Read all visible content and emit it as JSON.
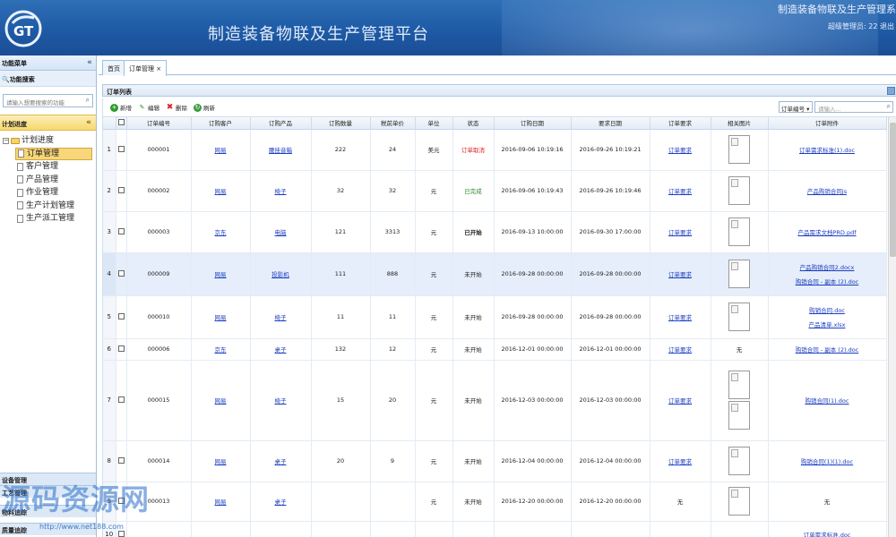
{
  "header": {
    "app_title": "制造装备物联及生产管理平台",
    "corner_title": "制造装备物联及生产管理系",
    "user_info": "超级管理员: 22  退出",
    "colors": {
      "primary": "#1e5aa6",
      "accent": "#f6d86e"
    }
  },
  "sidebar": {
    "title": "功能菜单",
    "collapse_icon": "«",
    "search_title": "功能搜索",
    "search_placeholder": "请输入想要搜索的功能",
    "plan_title": "计划进度",
    "tree_root": "计划进度",
    "items": [
      {
        "label": "订单管理",
        "selected": true
      },
      {
        "label": "客户管理",
        "selected": false
      },
      {
        "label": "产品管理",
        "selected": false
      },
      {
        "label": "作业管理",
        "selected": false
      },
      {
        "label": "生产计划管理",
        "selected": false
      },
      {
        "label": "生产派工管理",
        "selected": false
      }
    ],
    "bottom_panels": [
      "设备管理",
      "工艺管理",
      "物料追踪",
      "质量追踪"
    ]
  },
  "watermark": {
    "text": "源码资源网",
    "url": "http://www.net188.com"
  },
  "tabs": [
    {
      "label": "首页",
      "active": false
    },
    {
      "label": "订单管理",
      "active": true,
      "close": "×"
    }
  ],
  "panel": {
    "title": "订单列表"
  },
  "toolbar": {
    "add": "新增",
    "edit": "编辑",
    "delete": "删除",
    "refresh": "刷新",
    "search_field": "订单编号",
    "search_placeholder": "请输入..."
  },
  "table": {
    "columns": [
      "订单编号",
      "订购客户",
      "订购产品",
      "订购数量",
      "税前单价",
      "单位",
      "状态",
      "订购日期",
      "要求日期",
      "订单要求",
      "相关图片",
      "订单附件"
    ],
    "rows": [
      {
        "n": "1",
        "id": "000001",
        "customer": "网易",
        "product": "腰挂音箱",
        "qty": "222",
        "price": "24",
        "unit": "美元",
        "status": "订单取消",
        "status_style": "red",
        "order_date": "2016-09-06 10:19:16",
        "req_date": "2016-09-26 10:19:21",
        "req": "订单要求",
        "images": 1,
        "attachments": [
          "订单需求标准(1).doc"
        ]
      },
      {
        "n": "2",
        "id": "000002",
        "customer": "网易",
        "product": "椅子",
        "qty": "32",
        "price": "32",
        "unit": "元",
        "status": "已完成",
        "status_style": "green",
        "order_date": "2016-09-06 10:19:43",
        "req_date": "2016-09-26 10:19:46",
        "req": "订单要求",
        "images": 1,
        "attachments": [
          "产品购销合同js"
        ]
      },
      {
        "n": "3",
        "id": "000003",
        "customer": "京东",
        "product": "电脑",
        "qty": "121",
        "price": "3313",
        "unit": "元",
        "status": "已开始",
        "status_style": "bold",
        "order_date": "2016-09-13 10:00:00",
        "req_date": "2016-09-30 17:00:00",
        "req": "订单要求",
        "images": 1,
        "attachments": [
          "产品需求文档PRD.pdf"
        ]
      },
      {
        "n": "4",
        "id": "000009",
        "customer": "网易",
        "product": "投影机",
        "qty": "111",
        "price": "888",
        "unit": "元",
        "status": "未开始",
        "status_style": "",
        "order_date": "2016-09-28 00:00:00",
        "req_date": "2016-09-28 00:00:00",
        "req": "订单要求",
        "images": 1,
        "attachments": [
          "产品购销合同2.docx",
          "购销合同 - 副本 (2).doc"
        ],
        "highlight": true
      },
      {
        "n": "5",
        "id": "000010",
        "customer": "网易",
        "product": "椅子",
        "qty": "11",
        "price": "11",
        "unit": "元",
        "status": "未开始",
        "status_style": "",
        "order_date": "2016-09-28 00:00:00",
        "req_date": "2016-09-28 00:00:00",
        "req": "订单要求",
        "images": 1,
        "attachments": [
          "购销合同.doc",
          "产品清单.xlsx"
        ]
      },
      {
        "n": "6",
        "id": "000006",
        "customer": "京东",
        "product": "桌子",
        "qty": "132",
        "price": "12",
        "unit": "元",
        "status": "未开始",
        "status_style": "",
        "order_date": "2016-12-01 00:00:00",
        "req_date": "2016-12-01 00:00:00",
        "req": "订单要求",
        "images": 0,
        "no_image_text": "无",
        "attachments": [
          "购销合同 - 副本 (2).doc"
        ]
      },
      {
        "n": "7",
        "id": "000015",
        "customer": "网易",
        "product": "椅子",
        "qty": "15",
        "price": "20",
        "unit": "元",
        "status": "未开始",
        "status_style": "",
        "order_date": "2016-12-03 00:00:00",
        "req_date": "2016-12-03 00:00:00",
        "req": "订单要求",
        "images": 2,
        "attachments": [
          "购销合同(1).doc"
        ]
      },
      {
        "n": "8",
        "id": "000014",
        "customer": "网易",
        "product": "桌子",
        "qty": "20",
        "price": "9",
        "unit": "元",
        "status": "未开始",
        "status_style": "",
        "order_date": "2016-12-04 00:00:00",
        "req_date": "2016-12-04 00:00:00",
        "req": "订单要求",
        "images": 1,
        "attachments": [
          "购销合同(1)(1).doc"
        ]
      },
      {
        "n": "9",
        "id": "000013",
        "customer": "网易",
        "product": "桌子",
        "qty": "",
        "price": "",
        "unit": "元",
        "status": "未开始",
        "status_style": "",
        "order_date": "2016-12-20 00:00:00",
        "req_date": "2016-12-20 00:00:00",
        "req": "无",
        "req_plain": true,
        "images": 1,
        "attachments": [],
        "attach_plain": "无"
      },
      {
        "n": "10",
        "id": "",
        "customer": "",
        "product": "",
        "qty": "",
        "price": "",
        "unit": "",
        "status": "",
        "status_style": "",
        "order_date": "",
        "req_date": "",
        "req": "",
        "images": 0,
        "attachments": [
          "订单需求标准.doc"
        ]
      }
    ]
  }
}
